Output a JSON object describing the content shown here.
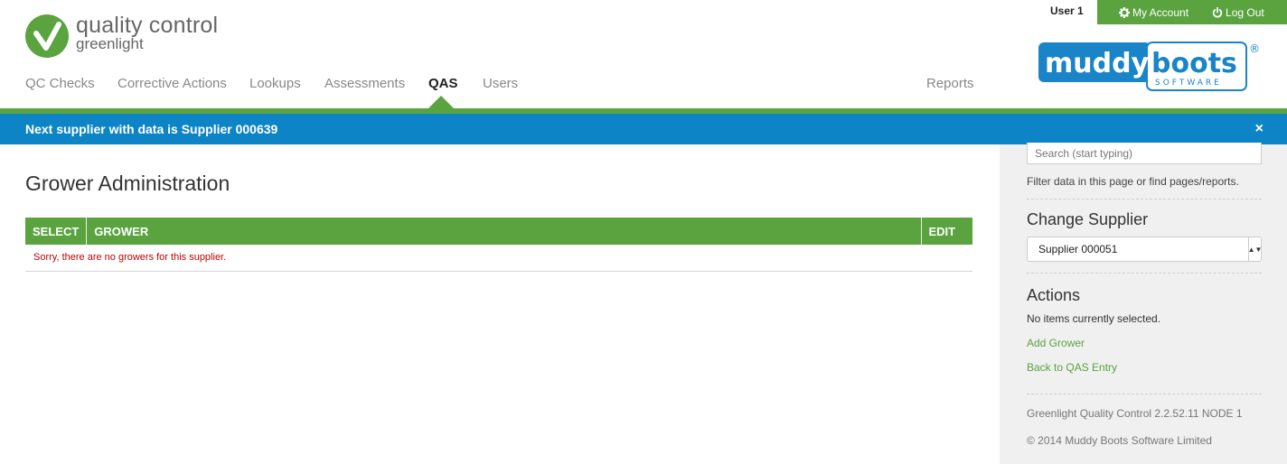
{
  "logo": {
    "title": "quality control",
    "subtitle": "greenlight"
  },
  "nav": [
    {
      "label": "QC Checks"
    },
    {
      "label": "Corrective Actions"
    },
    {
      "label": "Lookups"
    },
    {
      "label": "Assessments"
    },
    {
      "label": "QAS",
      "active": true
    },
    {
      "label": "Users"
    },
    {
      "label": "Reports"
    }
  ],
  "user": {
    "name": "User 1",
    "my_account": "My Account",
    "log_out": "Log Out"
  },
  "brand": {
    "name_a": "muddy",
    "name_b": "boots",
    "tagline": "SOFTWARE",
    "registered": "®"
  },
  "notice": {
    "text": "Next supplier with data is Supplier 000639",
    "close": "×"
  },
  "main": {
    "title": "Grower Administration",
    "columns": [
      "SELECT",
      "GROWER",
      "EDIT"
    ],
    "empty_message": "Sorry, there are no growers for this supplier."
  },
  "sidebar": {
    "search_placeholder": "Search (start typing)",
    "hint": "Filter data in this page or find pages/reports.",
    "change_supplier_heading": "Change Supplier",
    "supplier_selected": "Supplier 000051",
    "actions_heading": "Actions",
    "no_items": "No items currently selected.",
    "links": [
      "Add Grower",
      "Back to QAS Entry"
    ],
    "version": "Greenlight Quality Control 2.2.52.11 NODE 1",
    "copyright": "© 2014 Muddy Boots Software Limited"
  },
  "colors": {
    "brand_green": "#5aa33f",
    "notice_blue": "#0d84c6",
    "error_red": "#c00000",
    "logo_blue": "#1a84c8"
  },
  "icons": [
    "check-logo-icon",
    "gear-icon",
    "power-icon",
    "close-icon",
    "dropdown-arrow-icon"
  ]
}
